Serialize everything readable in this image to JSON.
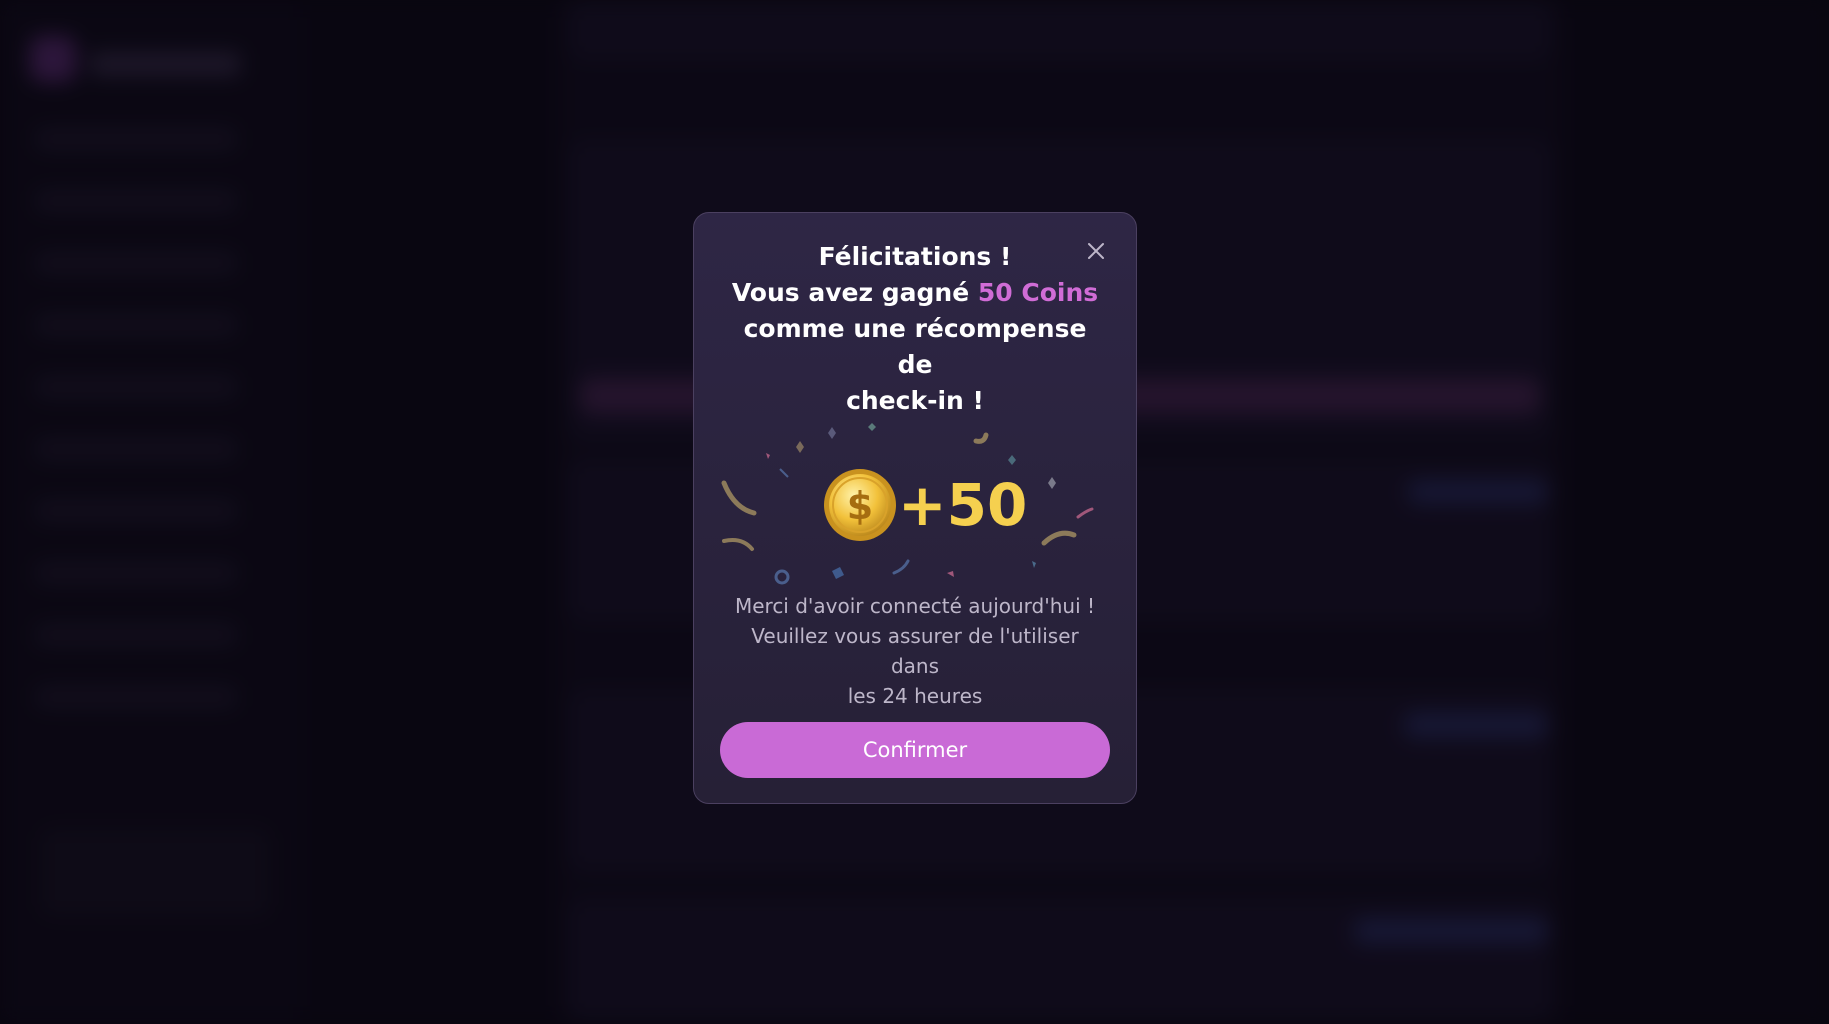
{
  "modal": {
    "title_line1": "Félicitations !",
    "title_line2_prefix": "Vous avez gagné",
    "title_highlight": "50 Coins",
    "title_line3": "comme une récompense de",
    "title_line4": "check-in !",
    "reward_amount": "+50",
    "note_line1": "Merci d'avoir connecté aujourd'hui !",
    "note_line2": "Veuillez vous assurer de l'utiliser dans",
    "note_line3": "les 24 heures",
    "confirm_label": "Confirmer",
    "icons": {
      "close": "close-icon",
      "coin": "coin-icon"
    }
  },
  "colors": {
    "accent": "#c96ad6",
    "highlight": "#d06cd6",
    "coin_text": "#f5d04f",
    "modal_bg": "#2a2340"
  }
}
